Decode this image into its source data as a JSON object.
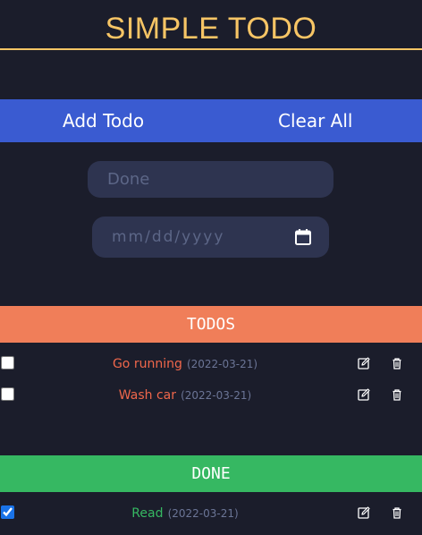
{
  "header": {
    "title": "SIMPLE TODO"
  },
  "actions": {
    "add_label": "Add Todo",
    "clear_label": "Clear All"
  },
  "form": {
    "todo_placeholder": "Done",
    "date_placeholder": "mm/dd/yyyy"
  },
  "todos": {
    "heading": "TODOS",
    "items": [
      {
        "name": "Go running",
        "date": "(2022-03-21)",
        "checked": false
      },
      {
        "name": "Wash car",
        "date": "(2022-03-21)",
        "checked": false
      }
    ]
  },
  "done": {
    "heading": "DONE",
    "items": [
      {
        "name": "Read",
        "date": "(2022-03-21)",
        "checked": true
      }
    ]
  },
  "colors": {
    "background": "#1b1d2b",
    "title": "#f7c565",
    "action_bar": "#3a5bd1",
    "todos_header": "#f07e59",
    "done_header": "#36b862",
    "todo_text": "#f0674b",
    "done_text": "#36b862"
  },
  "icons": {
    "edit": "edit-icon",
    "delete": "trash-icon",
    "calendar": "calendar-icon"
  }
}
